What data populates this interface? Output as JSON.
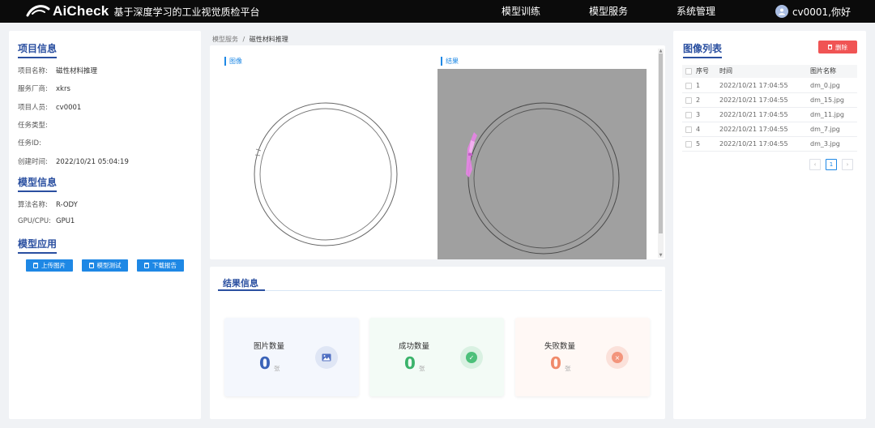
{
  "header": {
    "logo_text": "AiCheck",
    "platform_name": "基于深度学习的工业视觉质检平台",
    "nav": [
      "模型训练",
      "模型服务",
      "系统管理"
    ],
    "user_name": "cv0001,你好"
  },
  "left": {
    "project_title": "项目信息",
    "project": [
      {
        "key": "项目名称:",
        "value": "磁性材料推理"
      },
      {
        "key": "服务厂商:",
        "value": "xkrs"
      },
      {
        "key": "项目人员:",
        "value": "cv0001"
      },
      {
        "key": "任务类型:",
        "value": ""
      },
      {
        "key": "任务ID:",
        "value": ""
      },
      {
        "key": "创建时间:",
        "value": "2022/10/21 05:04:19"
      }
    ],
    "model_title": "模型信息",
    "model": [
      {
        "key": "算法名称:",
        "value": "R-ODY"
      },
      {
        "key": "GPU/CPU:",
        "value": "GPU1"
      }
    ],
    "app_title": "模型应用",
    "buttons": [
      "上传图片",
      "模型测试",
      "下载报告"
    ]
  },
  "breadcrumb": {
    "parent": "模型服务",
    "separator": "/",
    "current": "磁性材料推理"
  },
  "viewer": {
    "image_label": "图像",
    "result_label": "结果"
  },
  "result": {
    "title": "结果信息",
    "cards": [
      {
        "label": "图片数量",
        "value": "0",
        "unit": "张",
        "color": "#3a63b8",
        "bg": "#f4f7fd",
        "icon_bg": "#dfe6f5",
        "icon_fg": "#4f6fc2"
      },
      {
        "label": "成功数量",
        "value": "0",
        "unit": "张",
        "color": "#3bb36b",
        "bg": "#f3fbf6",
        "icon_bg": "#d9f1e2",
        "icon_fg": "#4cc07a"
      },
      {
        "label": "失败数量",
        "value": "0",
        "unit": "张",
        "color": "#f08a6a",
        "bg": "#fff8f5",
        "icon_bg": "#fbe1da",
        "icon_fg": "#f3957c"
      }
    ]
  },
  "image_list": {
    "title": "图像列表",
    "delete_label": "删除",
    "columns": [
      "序号",
      "时间",
      "图片名称"
    ],
    "rows": [
      {
        "index": "1",
        "time": "2022/10/21 17:04:55",
        "name": "dm_0.jpg"
      },
      {
        "index": "2",
        "time": "2022/10/21 17:04:55",
        "name": "dm_15.jpg"
      },
      {
        "index": "3",
        "time": "2022/10/21 17:04:55",
        "name": "dm_11.jpg"
      },
      {
        "index": "4",
        "time": "2022/10/21 17:04:55",
        "name": "dm_7.jpg"
      },
      {
        "index": "5",
        "time": "2022/10/21 17:04:55",
        "name": "dm_3.jpg"
      }
    ],
    "pagination": {
      "prev": "‹",
      "page": "1",
      "next": "›"
    }
  }
}
